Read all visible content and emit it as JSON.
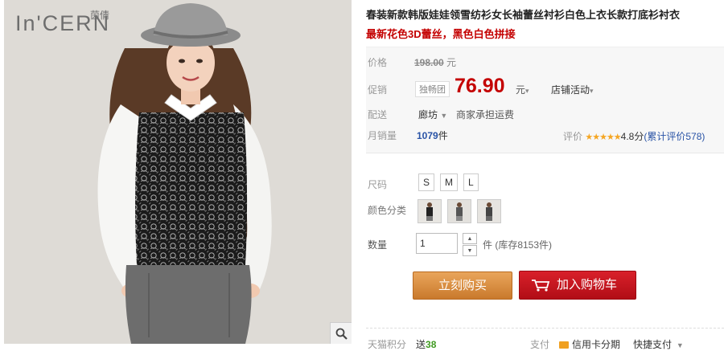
{
  "brand": {
    "logo_text": "In'CERN",
    "logo_cn": "茵倩"
  },
  "product": {
    "title_line1": "春装新款韩版娃娃领雪纺衫女长袖蕾丝衬衫白色上衣长款打底衫衬衣",
    "title_line2": "最新花色3D蕾丝，黑色白色拼接"
  },
  "price": {
    "label": "价格",
    "original": "198.00",
    "currency_unit": "元",
    "promo_label": "促销",
    "promo_tag": "独畅团",
    "promo_price": "76.90",
    "promo_unit": "元",
    "store_activity": "店铺活动"
  },
  "shipping": {
    "label": "配送",
    "location": "廊坊",
    "text": "商家承担运费"
  },
  "sales": {
    "label": "月销量",
    "count": "1079",
    "unit": "件",
    "rating_label": "评价",
    "stars": "★★★★★",
    "score": "4.8分",
    "rating_count": "(累计评价578)"
  },
  "options": {
    "size_label": "尺码",
    "sizes": [
      "S",
      "M",
      "L"
    ],
    "color_label": "颜色分类",
    "color_count": 3
  },
  "quantity": {
    "label": "数量",
    "value": "1",
    "stock": "件 (库存8153件)"
  },
  "actions": {
    "buy_now": "立刻购买",
    "add_to_cart": "加入购物车"
  },
  "footer": {
    "points_label": "天猫积分",
    "points_prefix": "送",
    "points_value": "38",
    "pay_label": "支付",
    "pay_credit": "信用卡分期",
    "pay_quick": "快捷支付"
  },
  "colors": {
    "accent_red": "#c40000",
    "link_blue": "#2953a6",
    "buy_orange": "#d98a3e",
    "cart_red": "#c4141d"
  }
}
